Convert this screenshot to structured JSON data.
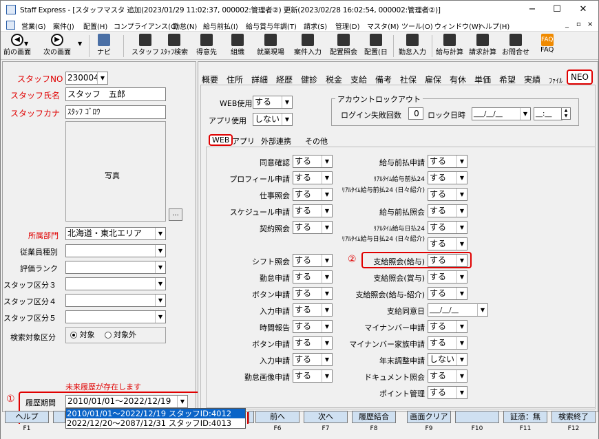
{
  "window": {
    "title": "Staff Express - [スタッフマスタ 追加(2023/01/29 11:02:37, 000002:管理者②) 更新(2023/02/28 16:02:54, 000002:管理者②)]",
    "min": "−",
    "max": "☐",
    "close": "✕",
    "mdi_min": "_",
    "mdi_restore": "▫",
    "mdi_close": "×"
  },
  "menu": [
    "営業(G)",
    "案件(J)",
    "配置(H)",
    "コンプライアンス(C)",
    "勤怠(N)",
    "給与前払(I)",
    "給与賞与年調(T)",
    "請求(S)",
    "管理(D)",
    "マスタ(M)",
    "ツール(O)",
    "ウィンドウ(W)",
    "ヘルプ(H)"
  ],
  "toolbar": {
    "prev": "前の画面",
    "next": "次の画面",
    "navi": "ナビ",
    "staff": "スタッフ",
    "staff_search": "ｽﾀｯﾌ検索",
    "client": "得意先",
    "org": "組織",
    "site": "就業現場",
    "case_input": "案件入力",
    "assign_view": "配置照会",
    "assign_day": "配置(日",
    "attendance": "勤怠入力",
    "salary_calc": "給与計算",
    "billing_calc": "請求計算",
    "inquiry": "お問合せ",
    "faq": "FAQ"
  },
  "left": {
    "staff_no_label": "スタッフNO",
    "staff_no": "230004",
    "name_label": "スタッフ氏名",
    "name": "スタッフ　五郎",
    "kana_label": "スタッフカナ",
    "kana": "ｽﾀｯﾌ ｺﾞﾛｳ",
    "photo": "写真",
    "photo_btn": "...",
    "dept_label": "所属部門",
    "dept": "北海道・東北エリア",
    "emp_type_label": "従業員種別",
    "rank_label": "評価ランク",
    "cat3_label": "スタッフ区分３",
    "cat4_label": "スタッフ区分４",
    "cat5_label": "スタッフ区分５",
    "search_label": "検索対象区分",
    "search_on": "対象",
    "search_off": "対象外",
    "future_note": "未来履歴が存在します",
    "marker1": "①",
    "period_label": "履歴期間",
    "period_value": "2010/01/01～2022/12/19",
    "period_options": [
      "2010/01/01～2022/12/19 スタッフID:4012",
      "2022/12/20～2087/12/31 スタッフID:4013"
    ]
  },
  "tabs": [
    "概要",
    "住所",
    "詳細",
    "経歴",
    "健診",
    "税金",
    "支給",
    "備考",
    "社保",
    "雇保",
    "有休",
    "単価",
    "希望",
    "実績",
    "ﾌｧｲﾙ",
    "NEO"
  ],
  "neo": {
    "web_use_label": "WEB使用",
    "web_use": "する",
    "app_use_label": "アプリ使用",
    "app_use": "しない",
    "lockout_title": "アカウントロックアウト",
    "fail_count_label": "ログイン失敗回数",
    "fail_count": "0",
    "lock_date_label": "ロック日時",
    "lock_date": "___/__/__",
    "lock_time": "__:__"
  },
  "subtabs": [
    "WEB",
    "アプリ",
    "外部連携",
    "その他"
  ],
  "web_left": [
    {
      "label": "同意確認",
      "value": "する"
    },
    {
      "label": "プロフィール申請",
      "value": "する"
    },
    {
      "label": "仕事照会",
      "value": "する"
    },
    {
      "label": "スケジュール申請",
      "value": "する"
    },
    {
      "label": "契約照会",
      "value": "する"
    },
    {
      "label": "シフト照会",
      "value": "する"
    },
    {
      "label": "勤怠申請",
      "value": "する"
    },
    {
      "label": "ボタン申請",
      "value": "する"
    },
    {
      "label": "入力申請",
      "value": "する"
    },
    {
      "label": "時間報告",
      "value": "する"
    },
    {
      "label": "ボタン申請",
      "value": "する"
    },
    {
      "label": "入力申請",
      "value": "する"
    },
    {
      "label": "勤怠画像申請",
      "value": "する"
    }
  ],
  "web_right": [
    {
      "label": "給与前払申請",
      "value": "する"
    },
    {
      "label": "ﾘｱﾙﾀｲﾑ給与前払24",
      "value": "する"
    },
    {
      "label": "ﾘｱﾙﾀｲﾑ給与前払24 (日々紹介)",
      "value": "する"
    },
    {
      "label": "給与前払照会",
      "value": "する"
    },
    {
      "label": "ﾘｱﾙﾀｲﾑ給与日払24",
      "value": "する"
    },
    {
      "label": "ﾘｱﾙﾀｲﾑ給与日払24 (日々紹介)",
      "value": "する"
    },
    {
      "label": "支給照会(給与)",
      "value": "する"
    },
    {
      "label": "支給照会(賞与)",
      "value": "する"
    },
    {
      "label": "支給照会(給与-紹介)",
      "value": "する"
    },
    {
      "label": "支給同意日",
      "value": "___/__/__"
    },
    {
      "label": "マイナンバー申請",
      "value": "する"
    },
    {
      "label": "マイナンバー家族申請",
      "value": "する"
    },
    {
      "label": "年末調整申請",
      "value": "しない"
    },
    {
      "label": "ドキュメント照会",
      "value": "する"
    },
    {
      "label": "ポイント管理",
      "value": "する"
    }
  ],
  "marker2": "②",
  "fkeys": [
    {
      "label": "ヘルプ",
      "key": "F1"
    },
    {
      "label": "",
      "key": ""
    },
    {
      "label": "",
      "key": ""
    },
    {
      "label": "",
      "key": ""
    },
    {
      "label": "",
      "key": ""
    },
    {
      "label": "前へ",
      "key": "F6"
    },
    {
      "label": "次へ",
      "key": "F7"
    },
    {
      "label": "履歴結合",
      "key": "F8"
    },
    {
      "label": "画面クリア",
      "key": "F9"
    },
    {
      "label": "",
      "key": "F10"
    },
    {
      "label": "証憑：無",
      "key": "F11"
    },
    {
      "label": "検索終了",
      "key": "F12"
    }
  ],
  "colors": {
    "highlight_red": "#e00000",
    "selected_blue": "#0a64c8",
    "fkey_blue": "#cfe0f1"
  }
}
